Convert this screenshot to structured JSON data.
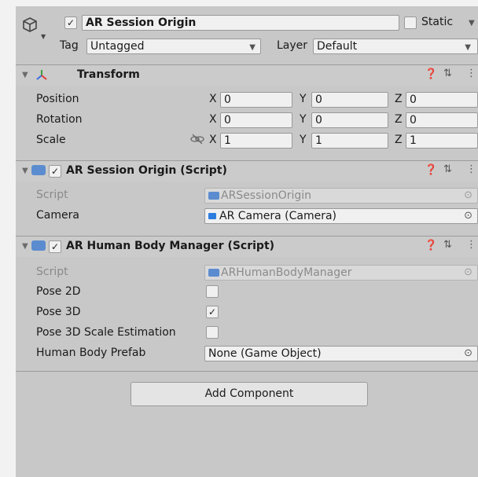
{
  "object": {
    "name": "AR Session Origin",
    "active": true,
    "static_label": "Static",
    "tag_label": "Tag",
    "tag_value": "Untagged",
    "layer_label": "Layer",
    "layer_value": "Default"
  },
  "transform": {
    "title": "Transform",
    "rows": [
      {
        "label": "Position",
        "x": "0",
        "y": "0",
        "z": "0"
      },
      {
        "label": "Rotation",
        "x": "0",
        "y": "0",
        "z": "0"
      },
      {
        "label": "Scale",
        "x": "1",
        "y": "1",
        "z": "1"
      }
    ],
    "axis": {
      "x": "X",
      "y": "Y",
      "z": "Z"
    }
  },
  "session_origin": {
    "title": "AR Session Origin (Script)",
    "enabled": true,
    "script_label": "Script",
    "script_value": "ARSessionOrigin",
    "camera_label": "Camera",
    "camera_value": "AR Camera (Camera)"
  },
  "body_manager": {
    "title": "AR Human Body Manager (Script)",
    "enabled": true,
    "script_label": "Script",
    "script_value": "ARHumanBodyManager",
    "pose2d_label": "Pose 2D",
    "pose2d": false,
    "pose3d_label": "Pose 3D",
    "pose3d": true,
    "pose3d_scale_label": "Pose 3D Scale Estimation",
    "pose3d_scale": false,
    "prefab_label": "Human Body Prefab",
    "prefab_value": "None (Game Object)"
  },
  "add_component_label": "Add Component",
  "icons": [
    "gameobject-icon",
    "transform-icon",
    "script-icon",
    "help-icon",
    "preset-icon",
    "menu-icon",
    "link-icon",
    "camera-icon",
    "object-picker-icon"
  ]
}
